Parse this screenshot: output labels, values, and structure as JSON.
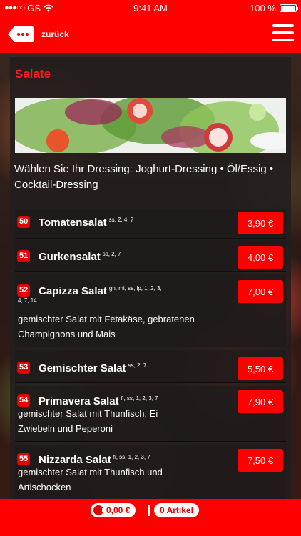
{
  "status_bar": {
    "carrier": "GS",
    "time": "9:41 AM",
    "battery": "100 %"
  },
  "nav": {
    "back_label": "zurück",
    "icons": [
      "back-arrow-icon",
      "hamburger-menu-icon"
    ]
  },
  "section": {
    "title": "Salate",
    "dressing_text": "Wählen Sie Ihr Dressing: Joghurt-Dressing • Öl/Essig • Cocktail-Dressing"
  },
  "items": [
    {
      "number": "50",
      "name": "Tomatensalat",
      "allergens": "ss, 2, 4, 7",
      "description": "",
      "price": "3,90 €"
    },
    {
      "number": "51",
      "name": "Gurkensalat",
      "allergens": "ss, 2, 7",
      "description": "",
      "price": "4,00 €"
    },
    {
      "number": "52",
      "name": "Capizza Salat",
      "allergens": "gh, mi, ss, lp, 1, 2, 3,",
      "allergens_cont": "4, 7, 14",
      "description": "gemischter Salat mit Fetakäse, gebratenen Champignons und Mais",
      "price": "7,00 €"
    },
    {
      "number": "53",
      "name": "Gemischter Salat",
      "allergens": "ss, 2, 7",
      "description": "",
      "price": "5,50 €"
    },
    {
      "number": "54",
      "name": "Primavera Salat",
      "allergens": "fi, ss, 1, 2, 3, 7",
      "description": "gemischter Salat mit Thunfisch, Ei Zwiebeln und Peperoni",
      "price": "7,90 €"
    },
    {
      "number": "55",
      "name": "Nizzarda Salat",
      "allergens": "fi, ss, 1, 2, 3, 7",
      "description": "gemischter Salat mit Thunfisch und Artischocken",
      "price": "7,50 €"
    }
  ],
  "footer": {
    "cart_total": "0,00 €",
    "article_count": "0 Artikel"
  },
  "colors": {
    "accent": "#ff0000",
    "panel": "#221e1e"
  }
}
